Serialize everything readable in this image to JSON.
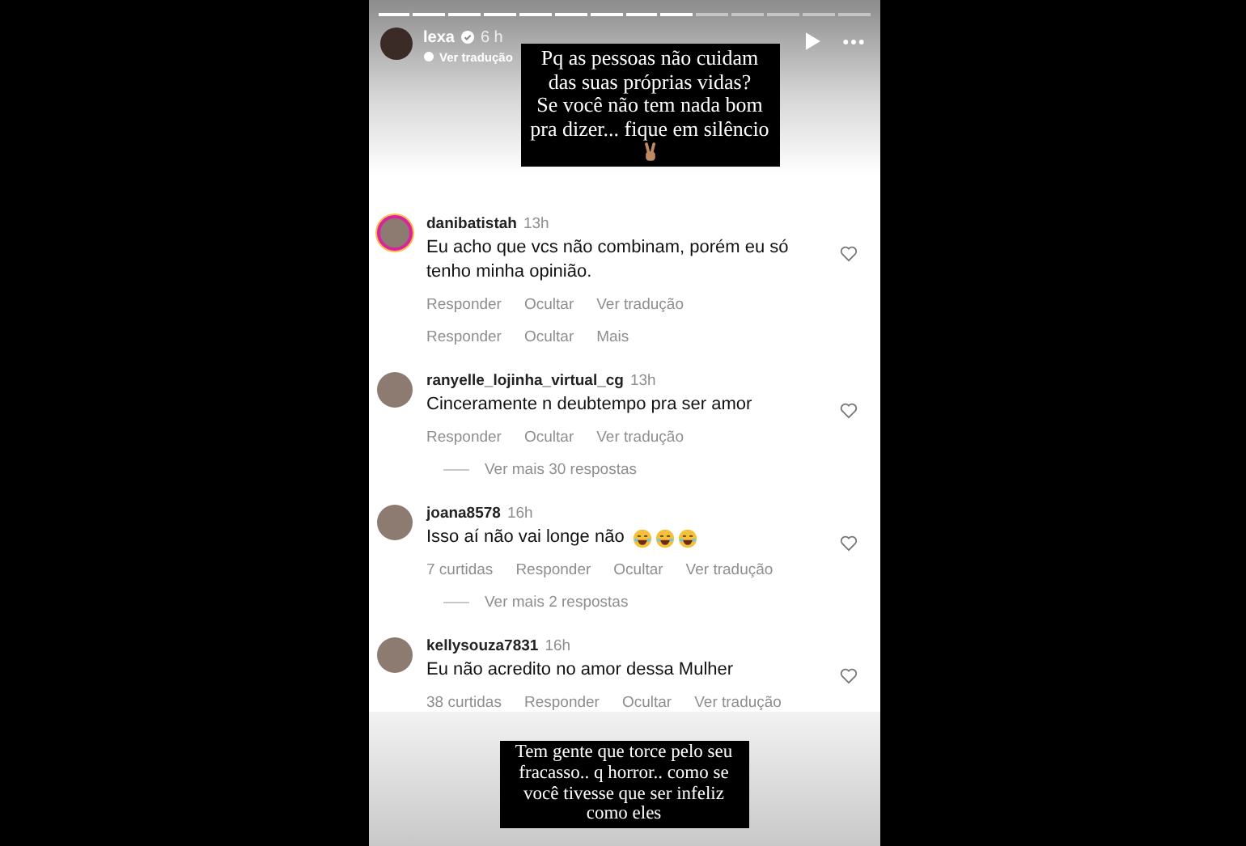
{
  "story": {
    "segments": [
      {
        "viewed": true
      },
      {
        "viewed": true
      },
      {
        "viewed": true
      },
      {
        "viewed": true
      },
      {
        "viewed": true
      },
      {
        "viewed": true
      },
      {
        "viewed": true
      },
      {
        "viewed": true
      },
      {
        "viewed": true
      },
      {
        "viewed": false
      },
      {
        "viewed": false
      },
      {
        "viewed": false
      },
      {
        "viewed": false
      },
      {
        "viewed": false
      }
    ],
    "author": "lexa",
    "verified": true,
    "time": "6 h",
    "translate": "Ver tradução",
    "caption_top": [
      "Pq as pessoas não cuidam",
      "das suas próprias vidas?",
      "Se você não tem nada bom",
      "pra dizer... fique em silêncio"
    ],
    "caption_bottom": [
      "Tem gente que torce pelo seu",
      "fracasso.. q horror.. como se",
      "você tivesse que ser infeliz",
      "como eles"
    ]
  },
  "comments": [
    {
      "kind": "comment",
      "username": "danibatistah",
      "time": "13h",
      "text": "Eu acho que vcs não combinam, porém eu só tenho minha opinião.",
      "story_ring": true,
      "liked": false,
      "action_rows": [
        [
          "Responder",
          "Ocultar",
          "Ver tradução"
        ],
        [
          "Responder",
          "Ocultar",
          "Mais"
        ]
      ]
    },
    {
      "kind": "comment",
      "username": "ranyelle_lojinha_virtual_cg",
      "time": "13h",
      "text": "Cinceramente  n deubtempo pra ser amor",
      "story_ring": false,
      "liked": false,
      "action_rows": [
        [
          "Responder",
          "Ocultar",
          "Ver tradução"
        ]
      ]
    },
    {
      "kind": "more",
      "text": "Ver mais 30 respostas"
    },
    {
      "kind": "comment",
      "username": "joana8578",
      "time": "16h",
      "text": "Isso aí não vai longe não",
      "emojis": [
        {
          "kind": "laughing"
        },
        {
          "kind": "laughing"
        },
        {
          "kind": "laughing"
        }
      ],
      "story_ring": false,
      "liked": false,
      "action_rows": [
        [
          "7 curtidas",
          "Responder",
          "Ocultar",
          "Ver tradução"
        ]
      ]
    },
    {
      "kind": "more",
      "text": "Ver mais 2 respostas"
    },
    {
      "kind": "comment",
      "username": "kellysouza7831",
      "time": "16h",
      "text": "Eu não acredito no amor dessa Mulher",
      "story_ring": false,
      "liked": false,
      "action_rows": [
        [
          "38 curtidas",
          "Responder",
          "Ocultar",
          "Ver tradução"
        ]
      ]
    }
  ]
}
